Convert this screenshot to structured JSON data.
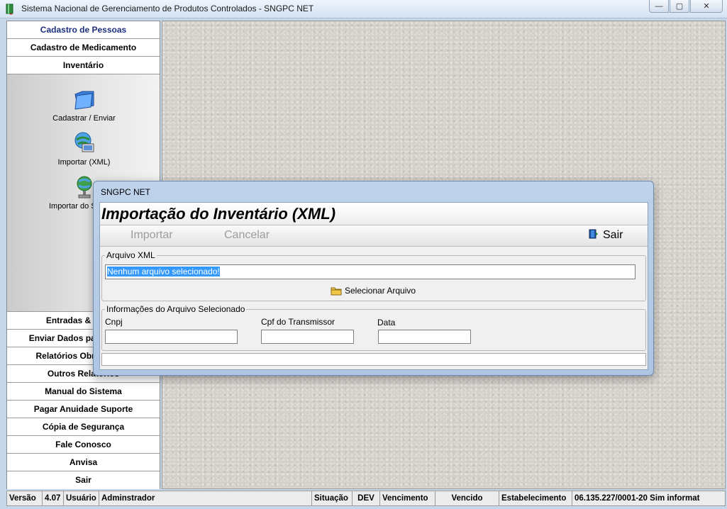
{
  "window": {
    "title": "Sistema Nacional de Gerenciamento de Produtos Controlados - SNGPC NET",
    "minimize": "▭",
    "maximize": "▢",
    "close": "✕"
  },
  "sidebar": {
    "top_items": [
      "Cadastro de Pessoas",
      "Cadastro de Medicamento",
      "Inventário"
    ],
    "tools": [
      "Cadastrar / Enviar",
      "Importar (XML)",
      "Importar do Sistema"
    ],
    "bottom_items": [
      "Entradas & Saídas",
      "Enviar Dados para ANVISA",
      "Relatórios Obrigatórios",
      "Outros Relatórios",
      "Manual do Sistema",
      "Pagar Anuidade Suporte",
      "Cópia de Segurança",
      "Fale Conosco",
      "Anvisa",
      "Sair"
    ]
  },
  "statusbar": {
    "versao_label": "Versão",
    "versao_value": "4.07",
    "usuario_label": "Usuário",
    "usuario_value": "Adminstrador",
    "situacao_label": "Situação",
    "situacao_value": "DEV",
    "vencimento_label": "Vencimento",
    "vencimento_value": "Vencido",
    "estabelecimento_label": "Estabelecimento",
    "estabelecimento_value": "06.135.227/0001-20 Sim informat"
  },
  "dialog": {
    "title": "SNGPC NET",
    "heading": "Importação do Inventário (XML)",
    "toolbar": {
      "import": "Importar",
      "cancel": "Cancelar",
      "exit": "Sair"
    },
    "file_group": {
      "legend": "Arquivo XML",
      "file_value": "Nenhum arquivo selecionado!",
      "select_button": "Selecionar Arquivo"
    },
    "info_group": {
      "legend": "Informações do Arquivo Selecionado",
      "cnpj_label": "Cnpj",
      "cpf_label": "Cpf do Transmissor",
      "date_label": "Data",
      "cnpj_value": "",
      "cpf_value": "",
      "date_value": ""
    }
  }
}
